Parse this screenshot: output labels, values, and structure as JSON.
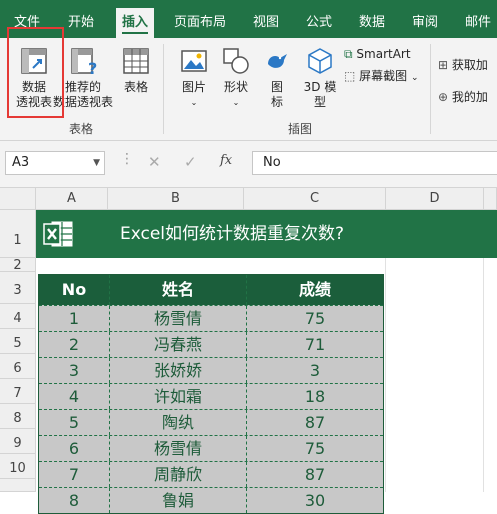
{
  "ribbon_tabs": [
    "文件",
    "开始",
    "插入",
    "页面布局",
    "视图",
    "公式",
    "数据",
    "审阅",
    "邮件"
  ],
  "active_tab": "插入",
  "ribbon": {
    "pivot_table": "数据\n透视表",
    "recommended_pivot": "推荐的\n数据透视表",
    "table": "表格",
    "group_tables": "表格",
    "picture": "图片",
    "shapes": "形状",
    "icons": "图\n标",
    "model3d": "3D 模\n型",
    "smartart": "SmartArt",
    "screenshot": "屏幕截图",
    "group_illustrations": "插图",
    "get_addins": "获取加",
    "my_addins": "我的加"
  },
  "formula_bar": {
    "name_box": "A3",
    "fx": "fx",
    "formula": "No"
  },
  "columns": [
    "A",
    "B",
    "C",
    "D"
  ],
  "rows": [
    "1",
    "2",
    "3",
    "4",
    "5",
    "6",
    "7",
    "8",
    "9",
    "10"
  ],
  "banner_title": "Excel如何统计数据重复次数?",
  "table": {
    "headers": [
      "No",
      "姓名",
      "成绩"
    ],
    "rows": [
      [
        "1",
        "杨雪倩",
        "75"
      ],
      [
        "2",
        "冯春燕",
        "71"
      ],
      [
        "3",
        "张娇娇",
        "3"
      ],
      [
        "4",
        "许如霜",
        "18"
      ],
      [
        "5",
        "陶纨",
        "87"
      ],
      [
        "6",
        "杨雪倩",
        "75"
      ],
      [
        "7",
        "周静欣",
        "87"
      ],
      [
        "8",
        "鲁娟",
        "30"
      ]
    ]
  },
  "colors": {
    "excel_green": "#217346",
    "table_header": "#1b5e3b",
    "highlight_box": "#e53935"
  }
}
